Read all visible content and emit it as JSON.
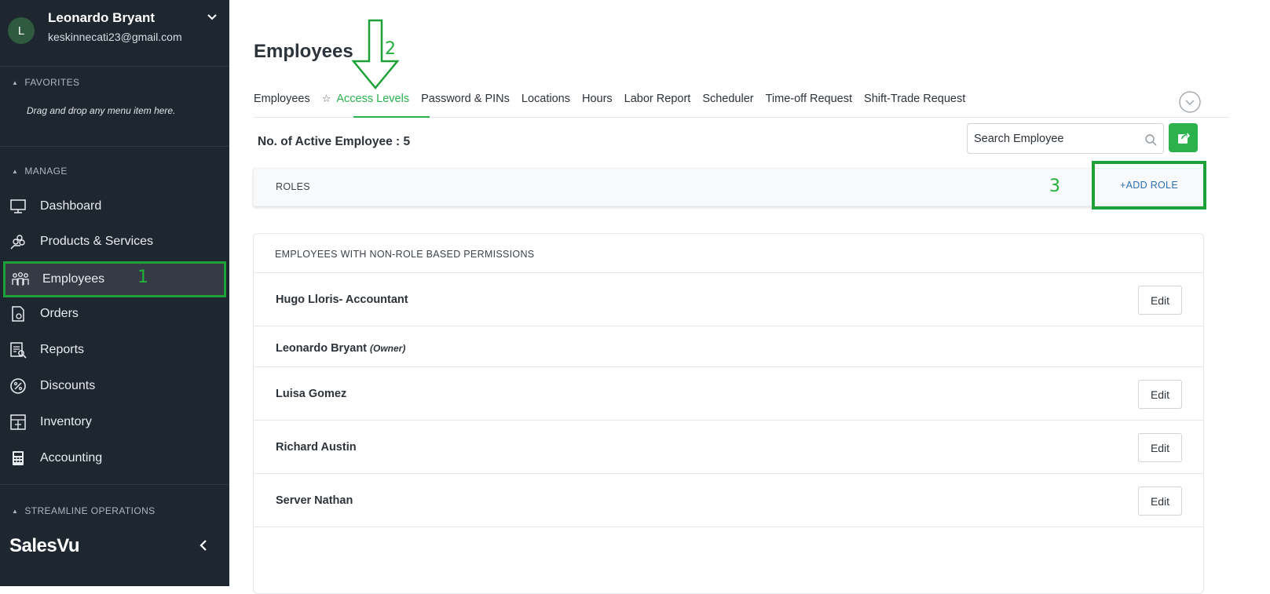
{
  "user": {
    "initial": "L",
    "name": "Leonardo Bryant",
    "email": "keskinnecati23@gmail.com"
  },
  "sidebar": {
    "favorites_title": "FAVORITES",
    "favorites_hint": "Drag and drop any menu item here.",
    "manage_title": "MANAGE",
    "items": [
      {
        "label": "Dashboard",
        "icon": "monitor-icon"
      },
      {
        "label": "Products & Services",
        "icon": "products-icon"
      },
      {
        "label": "Employees",
        "icon": "employees-icon",
        "active": true,
        "annotation": "1"
      },
      {
        "label": "Orders",
        "icon": "orders-icon"
      },
      {
        "label": "Reports",
        "icon": "reports-icon"
      },
      {
        "label": "Discounts",
        "icon": "discount-icon"
      },
      {
        "label": "Inventory",
        "icon": "inventory-icon"
      },
      {
        "label": "Accounting",
        "icon": "calculator-icon"
      }
    ],
    "streamline_title": "STREAMLINE OPERATIONS",
    "brand": "SalesVu"
  },
  "main": {
    "title": "Employees",
    "title_annotation": "2",
    "tabs": [
      {
        "label": "Employees"
      },
      {
        "label": "Access Levels",
        "active": true,
        "starred": true
      },
      {
        "label": "Password & PINs"
      },
      {
        "label": "Locations"
      },
      {
        "label": "Hours"
      },
      {
        "label": "Labor Report"
      },
      {
        "label": "Scheduler"
      },
      {
        "label": "Time-off Request"
      },
      {
        "label": "Shift-Trade Request"
      }
    ],
    "active_count_label": "No. of Active Employee : 5",
    "search_placeholder": "Search Employee",
    "roles_label": "ROLES",
    "roles_annotation": "3",
    "add_role_label": "+ADD ROLE",
    "non_role_title": "EMPLOYEES WITH NON-ROLE BASED PERMISSIONS",
    "employees": [
      {
        "name": "Hugo Lloris- Accountant",
        "tag": "",
        "editable": true
      },
      {
        "name": "Leonardo Bryant",
        "tag": "(Owner)",
        "editable": false
      },
      {
        "name": "Luisa Gomez",
        "tag": "",
        "editable": true
      },
      {
        "name": "Richard Austin",
        "tag": "",
        "editable": true
      },
      {
        "name": "Server Nathan",
        "tag": "",
        "editable": true
      }
    ],
    "edit_label": "Edit"
  },
  "colors": {
    "sidebar_bg": "#1e2630",
    "accent_green": "#2bb24c",
    "annotation_green": "#1fa13a",
    "link_blue": "#2f6fb5"
  }
}
